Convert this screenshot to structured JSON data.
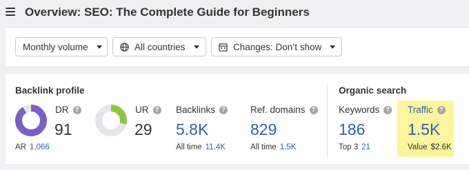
{
  "header": {
    "title": "Overview: SEO: The Complete Guide for Beginners",
    "menu_icon": "hamburger-menu-icon"
  },
  "filters": {
    "volume": {
      "label": "Monthly volume"
    },
    "country": {
      "label": "All countries",
      "icon": "globe-icon"
    },
    "changes": {
      "label": "Changes: Don’t show",
      "icon": "calendar-icon"
    }
  },
  "backlink_profile": {
    "title": "Backlink profile",
    "dr": {
      "label": "DR",
      "value": "91",
      "gauge_fraction": 0.91,
      "gauge_color": "#7b5fc4"
    },
    "ur": {
      "label": "UR",
      "value": "29",
      "gauge_fraction": 0.29,
      "gauge_color": "#8cc63f"
    },
    "ar": {
      "label": "AR",
      "value": "1,066"
    },
    "backlinks": {
      "label": "Backlinks",
      "value": "5.8K",
      "sub_label": "All time",
      "sub_value": "11.4K"
    },
    "ref_domains": {
      "label": "Ref. domains",
      "value": "829",
      "sub_label": "All time",
      "sub_value": "1.5K"
    }
  },
  "organic_search": {
    "title": "Organic search",
    "keywords": {
      "label": "Keywords",
      "value": "186",
      "sub_label": "Top 3",
      "sub_value": "21"
    },
    "traffic": {
      "label": "Traffic",
      "value": "1.5K",
      "sub_label": "Value",
      "sub_value": "$2.6K",
      "highlight_color": "#fbf59d"
    }
  },
  "colors": {
    "link": "#2f5fb0",
    "gauge_track": "#e6e6ea",
    "background": "#f0f0f2"
  }
}
